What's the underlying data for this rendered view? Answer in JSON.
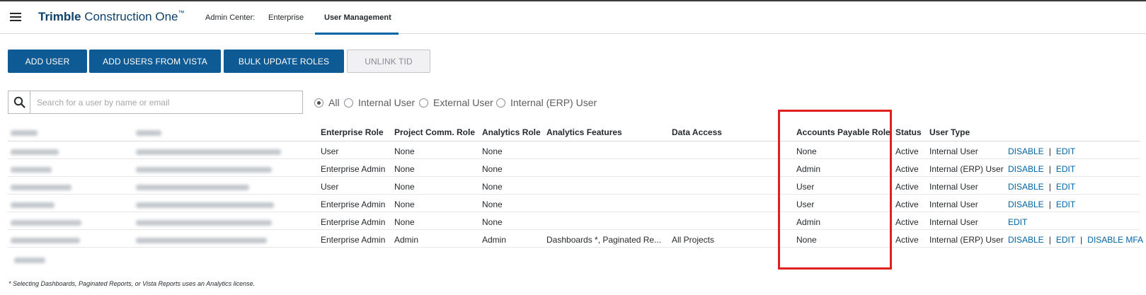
{
  "header": {
    "brand_bold": "Trimble",
    "brand_rest": " Construction One",
    "brand_tm": "™",
    "nav": [
      "Admin Center:",
      "Enterprise",
      "User Management"
    ]
  },
  "toolbar": {
    "add_user": "ADD USER",
    "add_users_vista": "ADD USERS FROM VISTA",
    "bulk_update_roles": "BULK UPDATE ROLES",
    "unlink_tid": "UNLINK TID"
  },
  "search": {
    "placeholder": "Search for a user by name or email"
  },
  "filters": {
    "options": [
      "All",
      "Internal User",
      "External User",
      "Internal (ERP) User"
    ],
    "selected": "All"
  },
  "table": {
    "headers": {
      "enterprise_role": "Enterprise Role",
      "project_comm_role": "Project Comm. Role",
      "analytics_role": "Analytics Role",
      "analytics_features": "Analytics Features",
      "data_access": "Data Access",
      "accounts_payable_role": "Accounts Payable Role",
      "status": "Status",
      "user_type": "User Type"
    },
    "rows": [
      {
        "enterprise_role": "User",
        "project_comm_role": "None",
        "analytics_role": "None",
        "analytics_features": "",
        "data_access": "",
        "accounts_payable_role": "None",
        "status": "Active",
        "user_type": "Internal User"
      },
      {
        "enterprise_role": "Enterprise Admin",
        "project_comm_role": "None",
        "analytics_role": "None",
        "analytics_features": "",
        "data_access": "",
        "accounts_payable_role": "Admin",
        "status": "Active",
        "user_type": "Internal (ERP) User"
      },
      {
        "enterprise_role": "User",
        "project_comm_role": "None",
        "analytics_role": "None",
        "analytics_features": "",
        "data_access": "",
        "accounts_payable_role": "User",
        "status": "Active",
        "user_type": "Internal User"
      },
      {
        "enterprise_role": "Enterprise Admin",
        "project_comm_role": "None",
        "analytics_role": "None",
        "analytics_features": "",
        "data_access": "",
        "accounts_payable_role": "User",
        "status": "Active",
        "user_type": "Internal User"
      },
      {
        "enterprise_role": "Enterprise Admin",
        "project_comm_role": "None",
        "analytics_role": "None",
        "analytics_features": "",
        "data_access": "",
        "accounts_payable_role": "Admin",
        "status": "Active",
        "user_type": "Internal User"
      },
      {
        "enterprise_role": "Enterprise Admin",
        "project_comm_role": "Admin",
        "analytics_role": "Admin",
        "analytics_features": "Dashboards *, Paginated Re...",
        "data_access": "All Projects",
        "accounts_payable_role": "None",
        "status": "Active",
        "user_type": "Internal (ERP) User"
      }
    ],
    "actions": {
      "disable": "DISABLE",
      "edit": "EDIT",
      "disable_mfa": "DISABLE MFA",
      "separator": "|"
    }
  },
  "footnote": "* Selecting Dashboards, Paginated Reports, or Vista Reports uses an Analytics license.",
  "colors": {
    "primary_button": "#0e5a94",
    "link": "#0063a3",
    "highlight_box": "#e0201f",
    "brand": "#0e416c"
  }
}
